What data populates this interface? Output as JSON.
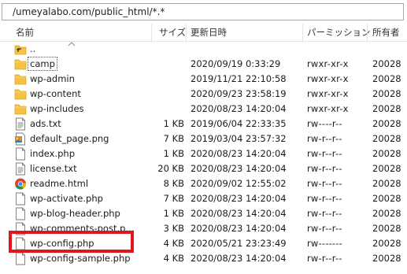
{
  "path": "/umeyalabo.com/public_html/*.*",
  "columns": {
    "name": "名前",
    "size": "サイズ",
    "modified": "更新日時",
    "permissions": "パーミッション",
    "owner": "所有者"
  },
  "rows": [
    {
      "name": "..",
      "size": "",
      "modified": "",
      "permissions": "",
      "owner": "",
      "icon": "parent-folder-icon"
    },
    {
      "name": "camp",
      "size": "",
      "modified": "2020/09/19 0:33:29",
      "permissions": "rwxr-xr-x",
      "owner": "20028",
      "icon": "folder-icon"
    },
    {
      "name": "wp-admin",
      "size": "",
      "modified": "2019/11/21 22:10:58",
      "permissions": "rwxr-xr-x",
      "owner": "20028",
      "icon": "folder-icon"
    },
    {
      "name": "wp-content",
      "size": "",
      "modified": "2020/09/23 23:58:19",
      "permissions": "rwxr-xr-x",
      "owner": "20028",
      "icon": "folder-icon"
    },
    {
      "name": "wp-includes",
      "size": "",
      "modified": "2020/08/23 14:20:04",
      "permissions": "rwxr-xr-x",
      "owner": "20028",
      "icon": "folder-icon"
    },
    {
      "name": "ads.txt",
      "size": "1 KB",
      "modified": "2019/06/04 22:33:35",
      "permissions": "rw----r--",
      "owner": "20028",
      "icon": "text-file-icon"
    },
    {
      "name": "default_page.png",
      "size": "7 KB",
      "modified": "2019/03/04 23:57:32",
      "permissions": "rw-r--r--",
      "owner": "20028",
      "icon": "image-file-icon"
    },
    {
      "name": "index.php",
      "size": "1 KB",
      "modified": "2020/08/23 14:20:04",
      "permissions": "rw-r--r--",
      "owner": "20028",
      "icon": "blank-file-icon"
    },
    {
      "name": "license.txt",
      "size": "20 KB",
      "modified": "2020/08/23 14:20:04",
      "permissions": "rw-r--r--",
      "owner": "20028",
      "icon": "text-file-icon"
    },
    {
      "name": "readme.html",
      "size": "8 KB",
      "modified": "2020/09/02 12:55:02",
      "permissions": "rw-r--r--",
      "owner": "20028",
      "icon": "chrome-icon"
    },
    {
      "name": "wp-activate.php",
      "size": "7 KB",
      "modified": "2020/08/23 14:20:04",
      "permissions": "rw-r--r--",
      "owner": "20028",
      "icon": "blank-file-icon"
    },
    {
      "name": "wp-blog-header.php",
      "size": "1 KB",
      "modified": "2020/08/23 14:20:04",
      "permissions": "rw-r--r--",
      "owner": "20028",
      "icon": "blank-file-icon"
    },
    {
      "name": "wp-comments-post.p...",
      "size": "3 KB",
      "modified": "2020/08/23 14:20:04",
      "permissions": "rw-r--r--",
      "owner": "20028",
      "icon": "blank-file-icon"
    },
    {
      "name": "wp-config.php",
      "size": "4 KB",
      "modified": "2020/05/21 23:23:49",
      "permissions": "rw-------",
      "owner": "20028",
      "icon": "blank-file-icon"
    },
    {
      "name": "wp-config-sample.php",
      "size": "4 KB",
      "modified": "2020/08/23 14:20:04",
      "permissions": "rw-r--r--",
      "owner": "20028",
      "icon": "blank-file-icon"
    }
  ],
  "colors": {
    "folder": "#f5c242",
    "highlight": "#e0161d"
  }
}
